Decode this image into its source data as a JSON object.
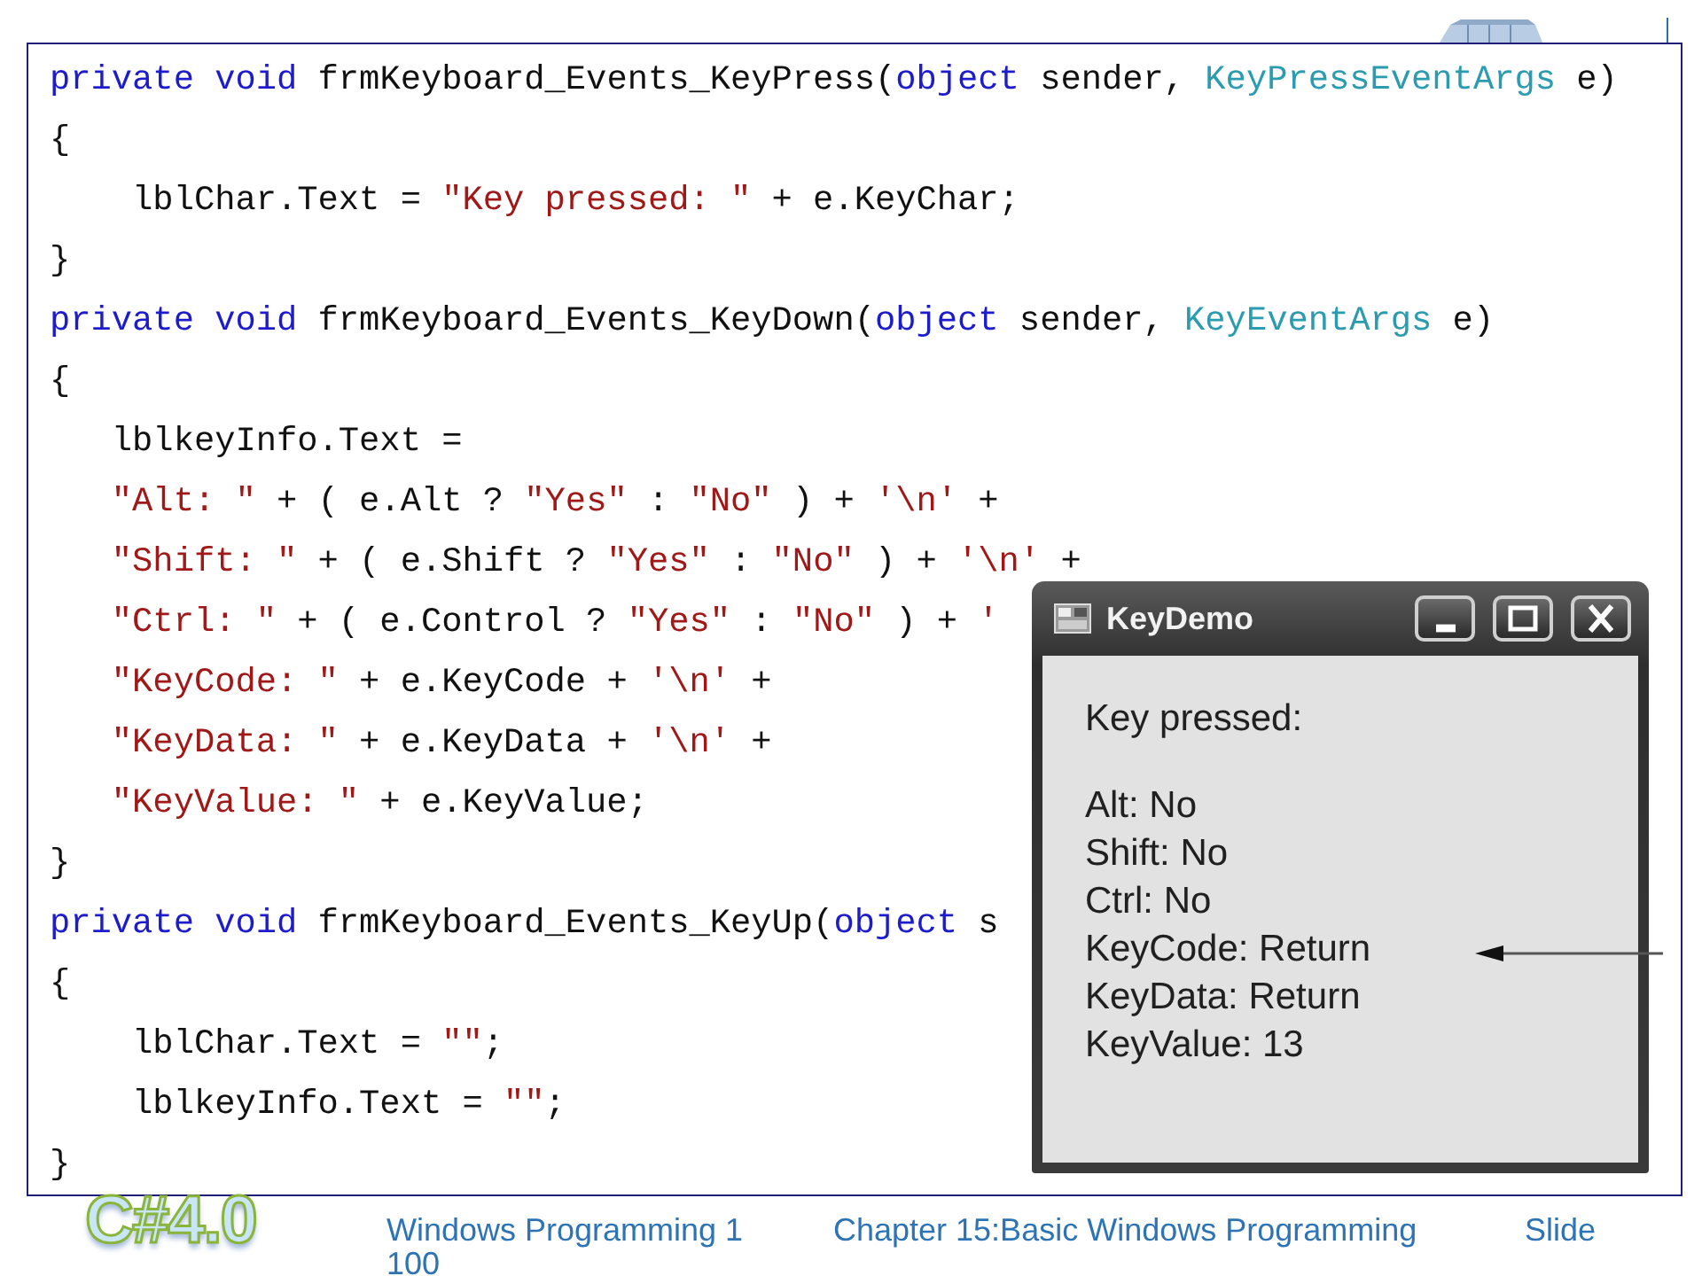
{
  "code_panel": {
    "lines": [
      [
        {
          "kind": "keyword",
          "text": "private void "
        },
        {
          "kind": "plain",
          "text": "frmKeyboard_Events_KeyPress("
        },
        {
          "kind": "keyword",
          "text": "object"
        },
        {
          "kind": "plain",
          "text": " sender, "
        },
        {
          "kind": "type",
          "text": "KeyPressEventArgs"
        },
        {
          "kind": "plain",
          "text": " e)"
        }
      ],
      [
        {
          "kind": "plain",
          "text": "{"
        }
      ],
      [
        {
          "kind": "plain",
          "text": "    lblChar.Text = "
        },
        {
          "kind": "string",
          "text": "\"Key pressed: \""
        },
        {
          "kind": "plain",
          "text": " + e.KeyChar;"
        }
      ],
      [
        {
          "kind": "plain",
          "text": "}"
        }
      ],
      [
        {
          "kind": "keyword",
          "text": "private void "
        },
        {
          "kind": "plain",
          "text": "frmKeyboard_Events_KeyDown("
        },
        {
          "kind": "keyword",
          "text": "object"
        },
        {
          "kind": "plain",
          "text": " sender, "
        },
        {
          "kind": "type",
          "text": "KeyEventArgs"
        },
        {
          "kind": "plain",
          "text": " e)"
        }
      ],
      [
        {
          "kind": "plain",
          "text": "{"
        }
      ],
      [
        {
          "kind": "plain",
          "text": "   lblkeyInfo.Text ="
        }
      ],
      [
        {
          "kind": "string",
          "text": "   \"Alt: \""
        },
        {
          "kind": "plain",
          "text": " + ( e.Alt ? "
        },
        {
          "kind": "string",
          "text": "\"Yes\""
        },
        {
          "kind": "plain",
          "text": " : "
        },
        {
          "kind": "string",
          "text": "\"No\""
        },
        {
          "kind": "plain",
          "text": " ) + "
        },
        {
          "kind": "string",
          "text": "'\\n'"
        },
        {
          "kind": "plain",
          "text": " +"
        }
      ],
      [
        {
          "kind": "string",
          "text": "   \"Shift: \""
        },
        {
          "kind": "plain",
          "text": " + ( e.Shift ? "
        },
        {
          "kind": "string",
          "text": "\"Yes\""
        },
        {
          "kind": "plain",
          "text": " : "
        },
        {
          "kind": "string",
          "text": "\"No\""
        },
        {
          "kind": "plain",
          "text": " ) + "
        },
        {
          "kind": "string",
          "text": "'\\n'"
        },
        {
          "kind": "plain",
          "text": " +"
        }
      ],
      [
        {
          "kind": "string",
          "text": "   \"Ctrl: \""
        },
        {
          "kind": "plain",
          "text": " + ( e.Control ? "
        },
        {
          "kind": "string",
          "text": "\"Yes\""
        },
        {
          "kind": "plain",
          "text": " : "
        },
        {
          "kind": "string",
          "text": "\"No\""
        },
        {
          "kind": "plain",
          "text": " ) + "
        },
        {
          "kind": "string",
          "text": "'"
        }
      ],
      [
        {
          "kind": "string",
          "text": "   \"KeyCode: \""
        },
        {
          "kind": "plain",
          "text": " + e.KeyCode + "
        },
        {
          "kind": "string",
          "text": "'\\n'"
        },
        {
          "kind": "plain",
          "text": " +"
        }
      ],
      [
        {
          "kind": "string",
          "text": "   \"KeyData: \""
        },
        {
          "kind": "plain",
          "text": " + e.KeyData + "
        },
        {
          "kind": "string",
          "text": "'\\n'"
        },
        {
          "kind": "plain",
          "text": " +"
        }
      ],
      [
        {
          "kind": "string",
          "text": "   \"KeyValue: \""
        },
        {
          "kind": "plain",
          "text": " + e.KeyValue;"
        }
      ],
      [
        {
          "kind": "plain",
          "text": "}"
        }
      ],
      [
        {
          "kind": "keyword",
          "text": "private void "
        },
        {
          "kind": "plain",
          "text": "frmKeyboard_Events_KeyUp("
        },
        {
          "kind": "keyword",
          "text": "object"
        },
        {
          "kind": "plain",
          "text": " s"
        }
      ],
      [
        {
          "kind": "plain",
          "text": "{"
        }
      ],
      [
        {
          "kind": "plain",
          "text": "    lblChar.Text = "
        },
        {
          "kind": "string",
          "text": "\"\""
        },
        {
          "kind": "plain",
          "text": ";"
        }
      ],
      [
        {
          "kind": "plain",
          "text": "    lblkeyInfo.Text = "
        },
        {
          "kind": "string",
          "text": "\"\""
        },
        {
          "kind": "plain",
          "text": ";"
        }
      ],
      [
        {
          "kind": "plain",
          "text": "}"
        }
      ]
    ]
  },
  "window": {
    "title": "KeyDemo",
    "key_label": "Key pressed:",
    "info_lines": [
      "Alt: No",
      "Shift: No",
      "Ctrl: No",
      "KeyCode: Return",
      "KeyData: Return",
      "KeyValue: 13"
    ]
  },
  "footer": {
    "logo": "C#4.0",
    "course": "Windows Programming 1",
    "chapter": "Chapter 15:Basic Windows Programming",
    "slide": "Slide",
    "slide_number": "100"
  }
}
